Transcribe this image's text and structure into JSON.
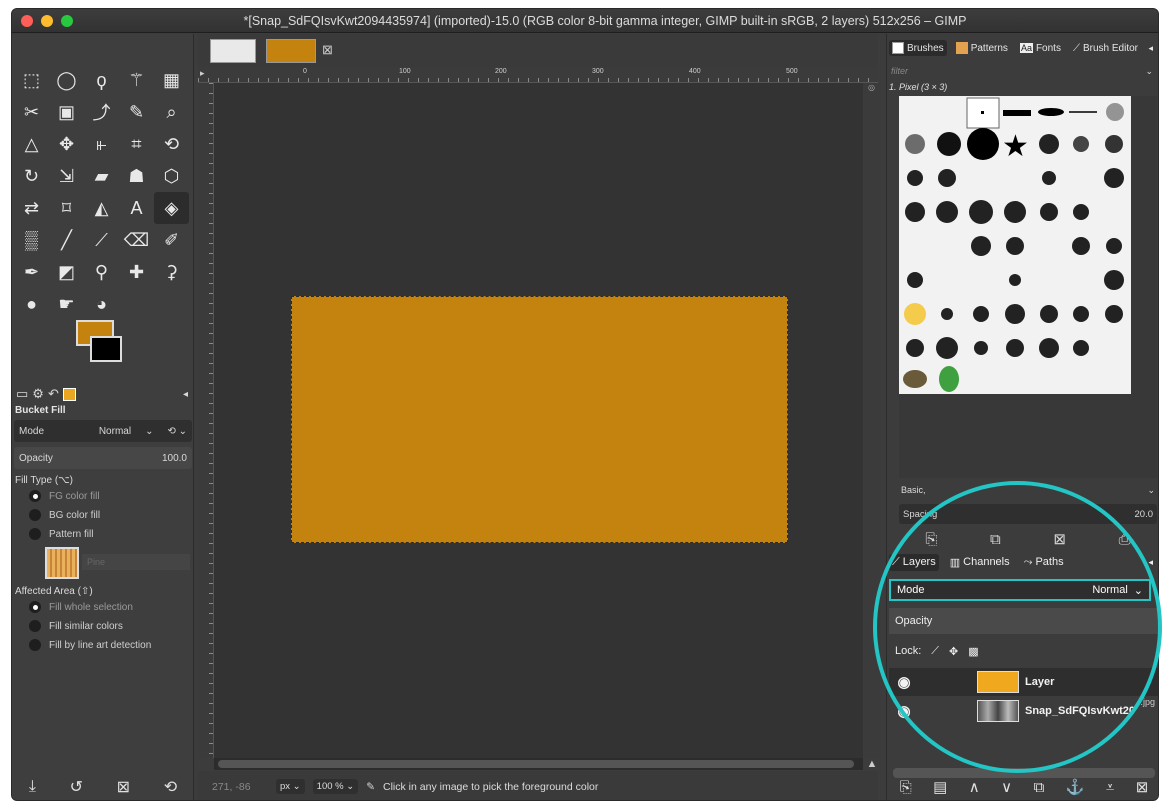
{
  "window": {
    "title": "*[Snap_SdFQIsvKwt2094435974] (imported)-15.0 (RGB color 8-bit gamma integer, GIMP built-in sRGB, 2 layers) 512x256 – GIMP"
  },
  "colors": {
    "fg": "#c4820f",
    "bg": "#000000",
    "accent_circle": "#23c5c5"
  },
  "ruler": {
    "ticks": [
      "0",
      "100",
      "200",
      "300",
      "400",
      "500"
    ]
  },
  "tool_options": {
    "title": "Bucket Fill",
    "mode_label": "Mode",
    "mode_value": "Normal",
    "opacity_label": "Opacity",
    "opacity_value": "100.0",
    "fill_type_label": "Fill Type  (⌥)",
    "fill_types": [
      "FG color fill",
      "BG color fill",
      "Pattern fill"
    ],
    "pattern_name": "Pine",
    "affected_area_label": "Affected Area  (⇧)",
    "affected_areas": [
      "Fill whole selection",
      "Fill similar colors",
      "Fill by line art detection"
    ]
  },
  "status": {
    "coords": "271, -86",
    "unit": "px",
    "zoom": "100 %",
    "message": "Click in any image to pick the foreground color"
  },
  "dock": {
    "tabs": [
      "Brushes",
      "Patterns",
      "Fonts",
      "Brush Editor"
    ],
    "filter_placeholder": "filter",
    "brush_name": "1. Pixel (3 × 3)",
    "preset": "Basic,",
    "spacing_label": "Spacing",
    "spacing_value": "20.0"
  },
  "layers": {
    "tabs": [
      "Layers",
      "Channels",
      "Paths"
    ],
    "mode_label": "Mode",
    "mode_value": "Normal",
    "opacity_label": "Opacity",
    "lock_label": "Lock:",
    "items": [
      {
        "name": "Layer",
        "color": "#f0a81e"
      },
      {
        "name": "Snap_SdFQIsvKwt20",
        "color": "#8a8a8a"
      }
    ],
    "side_note": ".jpg"
  }
}
